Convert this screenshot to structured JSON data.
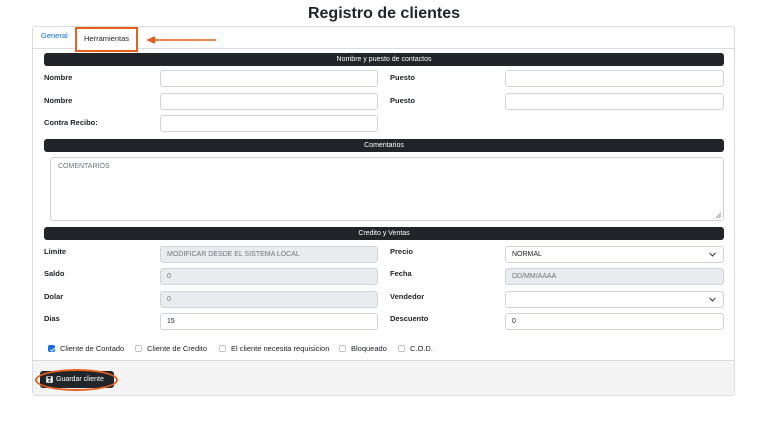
{
  "page_title": "Registro de clientes",
  "tabs": [
    {
      "label": "General"
    },
    {
      "label": "Herramientas"
    }
  ],
  "sections": {
    "contactos": "Nombre y puesto de contactos",
    "comentarios": "Comentarios",
    "credito": "Credito y Ventas"
  },
  "contactos": {
    "nombre1_label": "Nombre",
    "puesto1_label": "Puesto",
    "nombre2_label": "Nombre",
    "puesto2_label": "Puesto",
    "contra_recibo_label": "Contra Recibo:"
  },
  "comentarios": {
    "placeholder": "COMENTARIOS"
  },
  "credito": {
    "limite_label": "Limite",
    "limite_value": "MODIFICAR DESDE EL SISTEMA LOCAL",
    "saldo_label": "Saldo",
    "saldo_value": "0",
    "dolar_label": "Dolar",
    "dolar_value": "0",
    "dias_label": "Dias",
    "dias_value": "15",
    "precio_label": "Precio",
    "precio_value": "NORMAL",
    "fecha_label": "Fecha",
    "fecha_value": "DD/MM/AAAA",
    "vendedor_label": "Vendedor",
    "vendedor_value": "",
    "descuento_label": "Descuento",
    "descuento_value": "0"
  },
  "checkboxes": [
    {
      "label": "Cliente de Contado",
      "checked": true
    },
    {
      "label": "Cliente de Credito",
      "checked": false
    },
    {
      "label": "El cliente necesita requisicion",
      "checked": false
    },
    {
      "label": "Bloqueado",
      "checked": false
    },
    {
      "label": "C.O.D.",
      "checked": false
    }
  ],
  "footer": {
    "save_label": "Guardar cliente",
    "save_icon": "floppy-disk-icon"
  },
  "colors": {
    "accent_annotation": "#e8601c",
    "link": "#0d6efd",
    "dark": "#212529"
  }
}
